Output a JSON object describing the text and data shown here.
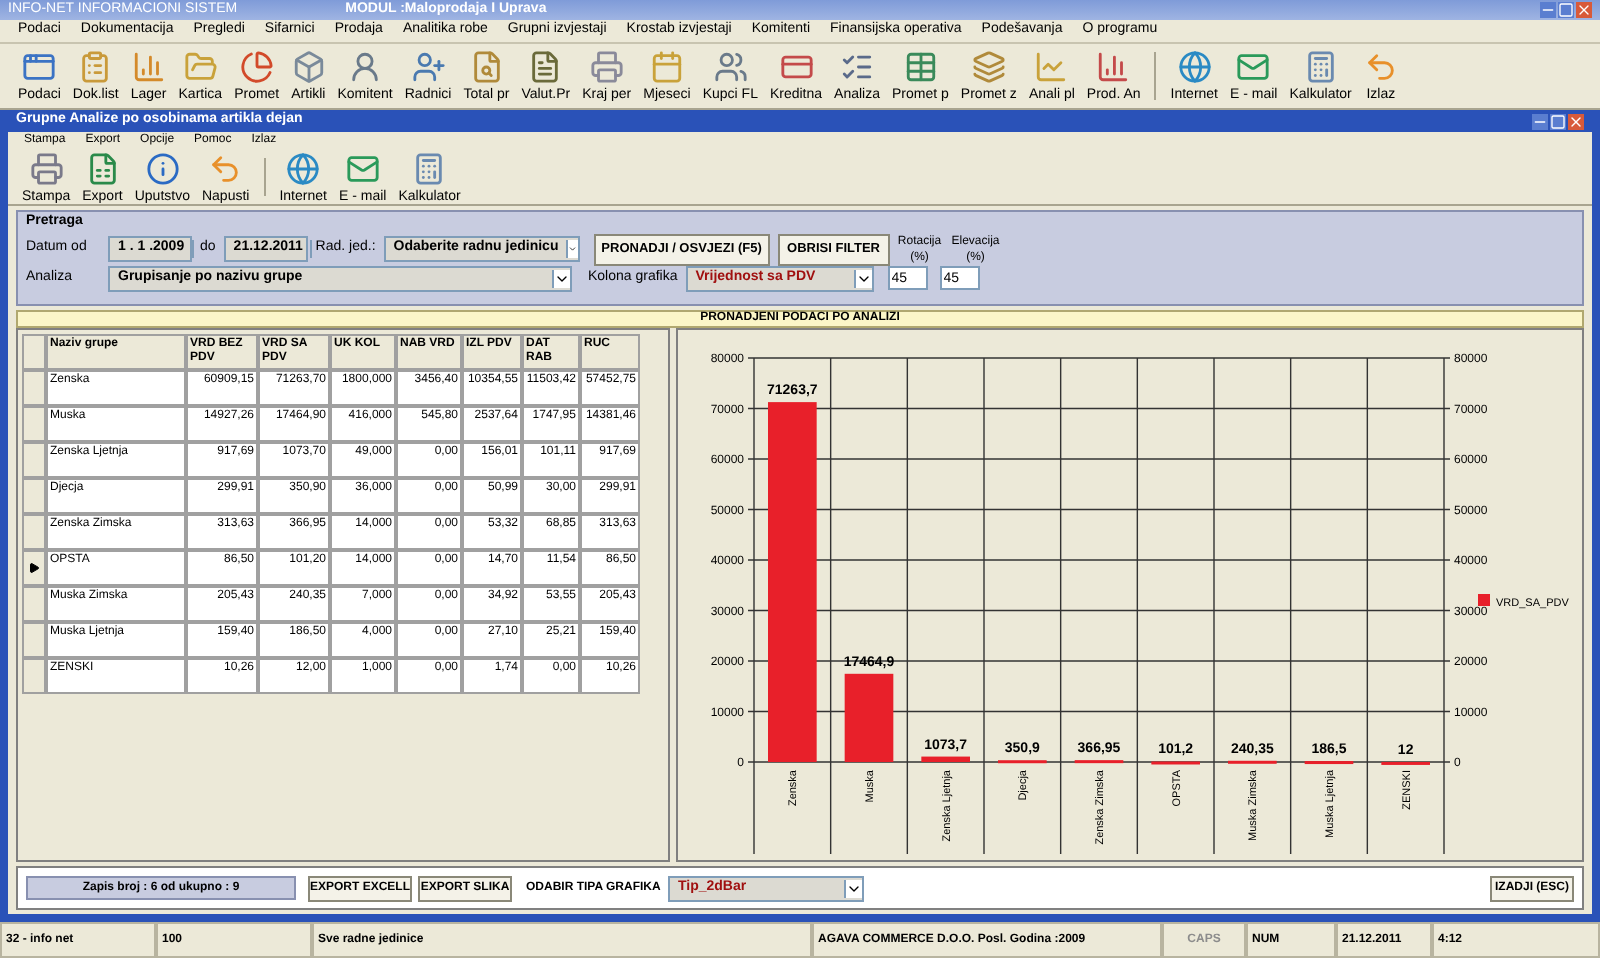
{
  "app_title": {
    "system": "INFO-NET INFORMACIONI SISTEM",
    "module": "MODUL :Maloprodaja I Uprava"
  },
  "menu": [
    "Podaci",
    "Dokumentacija",
    "Pregledi",
    "Sifarnici",
    "Prodaja",
    "Analitika robe",
    "Grupni izvjestaji",
    "Krostab izvjestaji",
    "Komitenti",
    "Finansijska operativa",
    "Podešavanja",
    "O programu"
  ],
  "toolbar": [
    {
      "label": "Podaci"
    },
    {
      "label": "Dok.list"
    },
    {
      "label": "Lager"
    },
    {
      "label": "Kartica"
    },
    {
      "label": "Promet"
    },
    {
      "label": "Artikli"
    },
    {
      "label": "Komitent"
    },
    {
      "label": "Radnici"
    },
    {
      "label": "Total pr"
    },
    {
      "label": "Valut.Pr"
    },
    {
      "label": "Kraj per"
    },
    {
      "label": "Mjeseci"
    },
    {
      "label": "Kupci FL"
    },
    {
      "label": "Kreditna"
    },
    {
      "label": "Analiza"
    },
    {
      "label": "Promet p"
    },
    {
      "label": "Promet z"
    },
    {
      "label": "Anali pl"
    },
    {
      "label": "Prod. An"
    },
    {
      "label": "Internet"
    },
    {
      "label": "E - mail"
    },
    {
      "label": "Kalkulator"
    },
    {
      "label": "Izlaz"
    }
  ],
  "window": {
    "title": "Grupne Analize po osobinama artikla dejan",
    "menu": [
      "Stampa",
      "Export",
      "Opcije",
      "Pomoc",
      "Izlaz"
    ],
    "toolbar": [
      {
        "label": "Stampa"
      },
      {
        "label": "Export"
      },
      {
        "label": "Uputstvo"
      },
      {
        "label": "Napusti"
      },
      {
        "label": "Internet"
      },
      {
        "label": "E - mail"
      },
      {
        "label": "Kalkulator"
      }
    ],
    "search": {
      "title": "Pretraga",
      "date_from_label": "Datum od",
      "date_from": "1 . 1 .2009",
      "date_to_label": "do",
      "date_to": "21.12.2011",
      "unit_label": "Rad. jed.:",
      "unit": "Odaberite radnu jedinicu",
      "find_button": "PRONADJI / OSVJEZI (F5)",
      "clear_button": "OBRISI FILTER",
      "rotation_label": "Rotacija (%)",
      "rotation": "45",
      "elevation_label": "Elevacija (%)",
      "elevation": "45",
      "analysis_label": "Analiza",
      "analysis": "Grupisanje po  nazivu grupe",
      "chart_column_label": "Kolona grafika",
      "chart_column": "Vrijednost sa PDV"
    },
    "results_title": "PRONADJENI PODACI PO ANALIZI",
    "table": {
      "columns": [
        "Naziv grupe",
        "VRD BEZ PDV",
        "VRD SA PDV",
        "UK KOL",
        "NAB VRD",
        "IZL PDV",
        "DAT RAB",
        "RUC"
      ],
      "rows": [
        {
          "selected": false,
          "cells": [
            "Zenska",
            "60909,15",
            "71263,70",
            "1800,000",
            "3456,40",
            "10354,55",
            "11503,42",
            "57452,75"
          ]
        },
        {
          "selected": false,
          "cells": [
            "Muska",
            "14927,26",
            "17464,90",
            "416,000",
            "545,80",
            "2537,64",
            "1747,95",
            "14381,46"
          ]
        },
        {
          "selected": false,
          "cells": [
            "Zenska Ljetnja",
            "917,69",
            "1073,70",
            "49,000",
            "0,00",
            "156,01",
            "101,11",
            "917,69"
          ]
        },
        {
          "selected": false,
          "cells": [
            "Djecja",
            "299,91",
            "350,90",
            "36,000",
            "0,00",
            "50,99",
            "30,00",
            "299,91"
          ]
        },
        {
          "selected": false,
          "cells": [
            "Zenska Zimska",
            "313,63",
            "366,95",
            "14,000",
            "0,00",
            "53,32",
            "68,85",
            "313,63"
          ]
        },
        {
          "selected": true,
          "cells": [
            "OPSTA",
            "86,50",
            "101,20",
            "14,000",
            "0,00",
            "14,70",
            "11,54",
            "86,50"
          ]
        },
        {
          "selected": false,
          "cells": [
            "Muska Zimska",
            "205,43",
            "240,35",
            "7,000",
            "0,00",
            "34,92",
            "53,55",
            "205,43"
          ]
        },
        {
          "selected": false,
          "cells": [
            "Muska Ljetnja",
            "159,40",
            "186,50",
            "4,000",
            "0,00",
            "27,10",
            "25,21",
            "159,40"
          ]
        },
        {
          "selected": false,
          "cells": [
            "ZENSKI",
            "10,26",
            "12,00",
            "1,000",
            "0,00",
            "1,74",
            "0,00",
            "10,26"
          ]
        }
      ]
    },
    "chart_data": {
      "type": "bar",
      "categories": [
        "Zenska",
        "Muska",
        "Zenska Ljetnja",
        "Djecja",
        "Zenska Zimska",
        "OPSTA",
        "Muska Zimska",
        "Muska Ljetnja",
        "ZENSKI"
      ],
      "series": [
        {
          "name": "VRD_SA_PDV",
          "color": "#e8202a",
          "values": [
            71263.7,
            17464.9,
            1073.7,
            350.9,
            366.95,
            101.2,
            240.35,
            186.5,
            12
          ]
        }
      ],
      "ylim": [
        0,
        80000
      ],
      "yticks": [
        0,
        10000,
        20000,
        30000,
        40000,
        50000,
        60000,
        70000,
        80000
      ],
      "y2lim": [
        0,
        80000
      ],
      "y2ticks": [
        0,
        10000,
        20000,
        30000,
        40000,
        50000,
        60000,
        70000,
        80000
      ],
      "grid": true,
      "value_labels": [
        "71263,7",
        "17464,9",
        "1073,7",
        "350,9",
        "366,95",
        "101,2",
        "240,35",
        "186,5",
        "12"
      ]
    },
    "footer": {
      "record": "Zapis broj : 6 od ukupno : 9",
      "export_excel": "EXPORT EXCELL",
      "export_image": "EXPORT SLIKA",
      "chart_type_label": "ODABIR TIPA GRAFIKA",
      "chart_type": "Tip_2dBar",
      "exit_button": "IZADJI (ESC)"
    }
  },
  "status_bar": [
    {
      "text": "32 - info net",
      "disabled": false
    },
    {
      "text": "100",
      "disabled": false
    },
    {
      "text": "Sve radne jedinice",
      "disabled": false
    },
    {
      "text": "AGAVA COMMERCE D.O.O.   Posl. Godina :2009",
      "disabled": false
    },
    {
      "text": "CAPS",
      "disabled": true
    },
    {
      "text": "NUM",
      "disabled": false
    },
    {
      "text": "21.12.2011",
      "disabled": false
    },
    {
      "text": "4:12",
      "disabled": false
    }
  ]
}
